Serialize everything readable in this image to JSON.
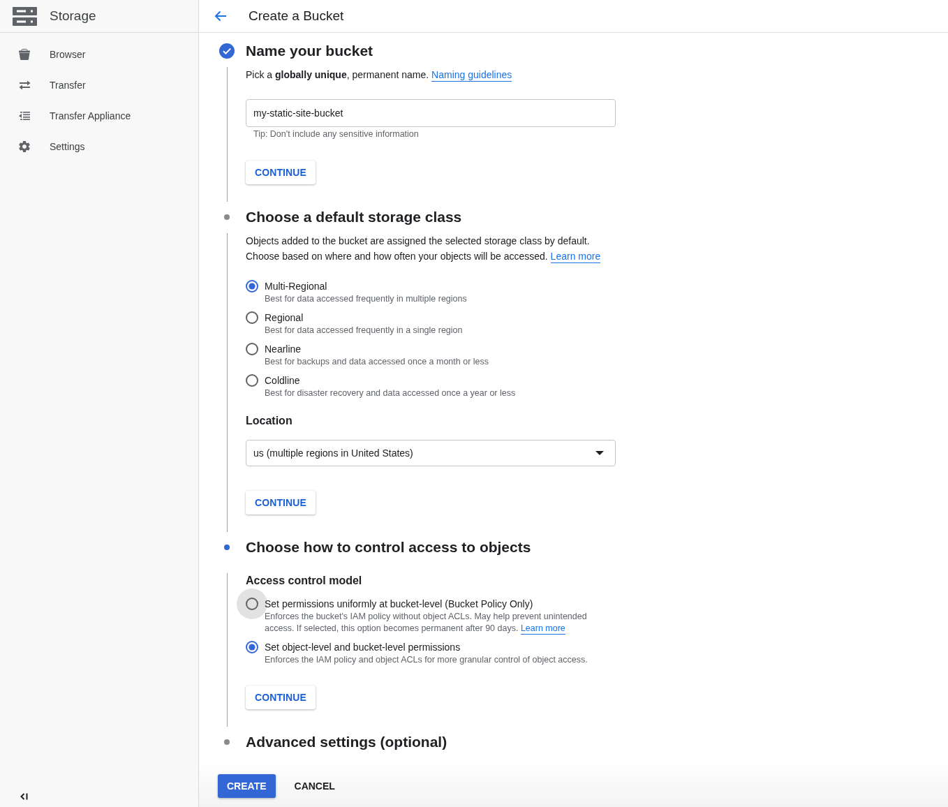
{
  "sidebar": {
    "title": "Storage",
    "items": [
      {
        "label": "Browser",
        "selected": false
      },
      {
        "label": "Transfer",
        "selected": false
      },
      {
        "label": "Transfer Appliance",
        "selected": false
      },
      {
        "label": "Settings",
        "selected": false
      }
    ]
  },
  "header": {
    "title": "Create a Bucket"
  },
  "steps": [
    {
      "completed": true,
      "active": false,
      "title": "Name your bucket",
      "blocks": [
        {
          "kind": "paragraph",
          "text": "Pick a **globally unique**, permanent name.",
          "link": "Naming guidelines"
        },
        {
          "kind": "text-field",
          "value": "my-static-site-bucket",
          "hint": "Tip: Don't include any sensitive information"
        },
        {
          "kind": "button",
          "label": "CONTINUE"
        }
      ]
    },
    {
      "completed": false,
      "active": false,
      "title": "Choose a default storage class",
      "blocks": [
        {
          "kind": "paragraph",
          "text": "Objects added to the bucket are assigned the selected storage class by default. Choose based on where and how often your objects will be accessed.",
          "link": "Learn more"
        },
        {
          "kind": "radio-group",
          "options": [
            {
              "label": "Multi-Regional",
              "description": "Best for data accessed frequently in multiple regions",
              "selected": true,
              "focused": false
            },
            {
              "label": "Regional",
              "description": "Best for data accessed frequently in a single region",
              "selected": false,
              "focused": false
            },
            {
              "label": "Nearline",
              "description": "Best for backups and data accessed once a month or less",
              "selected": false,
              "focused": false
            },
            {
              "label": "Coldline",
              "description": "Best for disaster recovery and data accessed once a year or less",
              "selected": false,
              "focused": false
            }
          ]
        },
        {
          "kind": "subheading",
          "text": "Location"
        },
        {
          "kind": "select",
          "value": "us (multiple regions in United States)"
        },
        {
          "kind": "button",
          "label": "CONTINUE"
        }
      ]
    },
    {
      "completed": false,
      "active": true,
      "title": "Choose how to control access to objects",
      "blocks": [
        {
          "kind": "subheading",
          "text": "Access control model"
        },
        {
          "kind": "radio-group",
          "options": [
            {
              "label": "Set permissions uniformly at bucket-level (Bucket Policy Only)",
              "description": "Enforces the bucket's IAM policy without object ACLs. May help prevent unintended access. If selected, this option becomes permanent after 90 days.",
              "link": "Learn more",
              "selected": false,
              "focused": true
            },
            {
              "label": "Set object-level and bucket-level permissions",
              "description": "Enforces the IAM policy and object ACLs for more granular control of object access.",
              "selected": true,
              "focused": false
            }
          ]
        },
        {
          "kind": "button",
          "label": "CONTINUE"
        }
      ]
    },
    {
      "completed": false,
      "active": false,
      "title": "Advanced settings (optional)"
    }
  ],
  "actions": [
    {
      "label": "CREATE",
      "kind": "primary"
    },
    {
      "label": "CANCEL",
      "kind": "text"
    }
  ]
}
